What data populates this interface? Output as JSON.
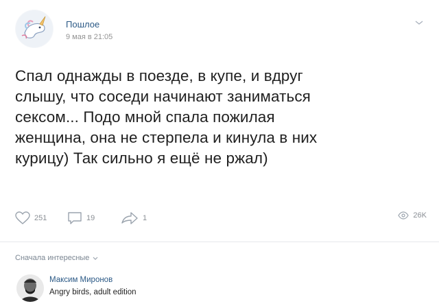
{
  "post": {
    "author": "Пошлое",
    "date": "9 мая в 21:05",
    "text_lines": [
      "Спал однажды в поезде, в купе, и вдруг",
      "слышу, что соседи начинают заниматься",
      "сексом... Подо мной спала пожилая",
      "женщина, она не стерпела и кинула в них",
      "курицу) Так сильно я ещё не ржал)"
    ]
  },
  "actions": {
    "likes": "251",
    "comments": "19",
    "shares": "1",
    "views": "26K"
  },
  "comments_sort": {
    "label": "Сначала интересные"
  },
  "comment": {
    "author": "Максим Миронов",
    "text": "Angry birds, adult edition"
  },
  "icons": {
    "like": "heart-icon",
    "comment": "comment-bubble-icon",
    "share": "share-arrow-icon",
    "views": "eye-icon",
    "menu": "chevron-down-icon",
    "sort": "chevron-down-icon"
  },
  "colors": {
    "link": "#2a5885",
    "muted": "#939393",
    "text": "#1f1f1f"
  }
}
